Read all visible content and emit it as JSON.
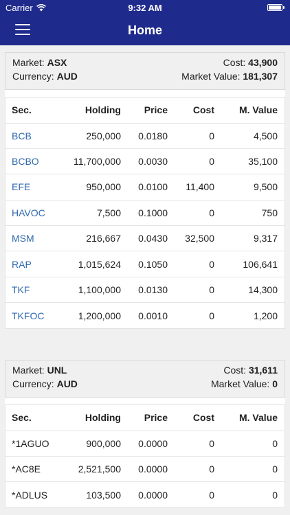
{
  "status": {
    "carrier": "Carrier",
    "time": "9:32 AM"
  },
  "nav": {
    "title": "Home"
  },
  "columns": [
    "Sec.",
    "Holding",
    "Price",
    "Cost",
    "M. Value"
  ],
  "sections": [
    {
      "market_label": "Market:",
      "market": "ASX",
      "currency_label": "Currency:",
      "currency": "AUD",
      "cost_label": "Cost:",
      "cost": "43,900",
      "mv_label": "Market Value:",
      "mv": "181,307",
      "rows": [
        {
          "sec": "BCB",
          "holding": "250,000",
          "price": "0.0180",
          "cost": "0",
          "mvalue": "4,500"
        },
        {
          "sec": "BCBO",
          "holding": "11,700,000",
          "price": "0.0030",
          "cost": "0",
          "mvalue": "35,100"
        },
        {
          "sec": "EFE",
          "holding": "950,000",
          "price": "0.0100",
          "cost": "11,400",
          "mvalue": "9,500"
        },
        {
          "sec": "HAVOC",
          "holding": "7,500",
          "price": "0.1000",
          "cost": "0",
          "mvalue": "750"
        },
        {
          "sec": "MSM",
          "holding": "216,667",
          "price": "0.0430",
          "cost": "32,500",
          "mvalue": "9,317"
        },
        {
          "sec": "RAP",
          "holding": "1,015,624",
          "price": "0.1050",
          "cost": "0",
          "mvalue": "106,641"
        },
        {
          "sec": "TKF",
          "holding": "1,100,000",
          "price": "0.0130",
          "cost": "0",
          "mvalue": "14,300"
        },
        {
          "sec": "TKFOC",
          "holding": "1,200,000",
          "price": "0.0010",
          "cost": "0",
          "mvalue": "1,200"
        }
      ]
    },
    {
      "market_label": "Market:",
      "market": "UNL",
      "currency_label": "Currency:",
      "currency": "AUD",
      "cost_label": "Cost:",
      "cost": "31,611",
      "mv_label": "Market Value:",
      "mv": "0",
      "rows": [
        {
          "sec": "*1AGUO",
          "holding": "900,000",
          "price": "0.0000",
          "cost": "0",
          "mvalue": "0"
        },
        {
          "sec": "*AC8E",
          "holding": "2,521,500",
          "price": "0.0000",
          "cost": "0",
          "mvalue": "0"
        },
        {
          "sec": "*ADLUS",
          "holding": "103,500",
          "price": "0.0000",
          "cost": "0",
          "mvalue": "0"
        }
      ]
    }
  ],
  "colors": {
    "nav_bg": "#1f2b8c",
    "link": "#2f69b0"
  }
}
